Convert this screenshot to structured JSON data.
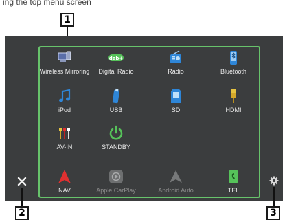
{
  "header_text": "ing the top menu screen",
  "callouts": {
    "one": "1",
    "two": "2",
    "three": "3"
  },
  "apps": [
    {
      "label": "Wireless Mirroring",
      "icon": "wireless-mirroring-icon"
    },
    {
      "label": "Digital Radio",
      "icon": "digital-radio-icon"
    },
    {
      "label": "Radio",
      "icon": "radio-icon"
    },
    {
      "label": "Bluetooth",
      "icon": "bluetooth-audio-icon"
    },
    {
      "label": "iPod",
      "icon": "music-note-icon"
    },
    {
      "label": "USB",
      "icon": "usb-icon"
    },
    {
      "label": "SD",
      "icon": "sd-card-icon"
    },
    {
      "label": "HDMI",
      "icon": "hdmi-icon"
    },
    {
      "label": "AV-IN",
      "icon": "av-in-icon"
    },
    {
      "label": "STANDBY",
      "icon": "power-icon"
    },
    {
      "label": "NAV",
      "icon": "navigation-arrow-icon"
    },
    {
      "label": "Apple CarPlay",
      "icon": "apple-carplay-icon"
    },
    {
      "label": "Android Auto",
      "icon": "android-auto-icon"
    },
    {
      "label": "TEL",
      "icon": "phone-icon"
    }
  ],
  "dimmed_apps": [
    "Apple CarPlay",
    "Android Auto"
  ],
  "buttons": {
    "close": "close-icon",
    "settings": "gear-icon"
  },
  "colors": {
    "screen_bg": "#3b3d3e",
    "panel_border": "#67c36b",
    "accent_red": "#e03030",
    "accent_green": "#56c25a",
    "accent_blue": "#2e86d8"
  }
}
